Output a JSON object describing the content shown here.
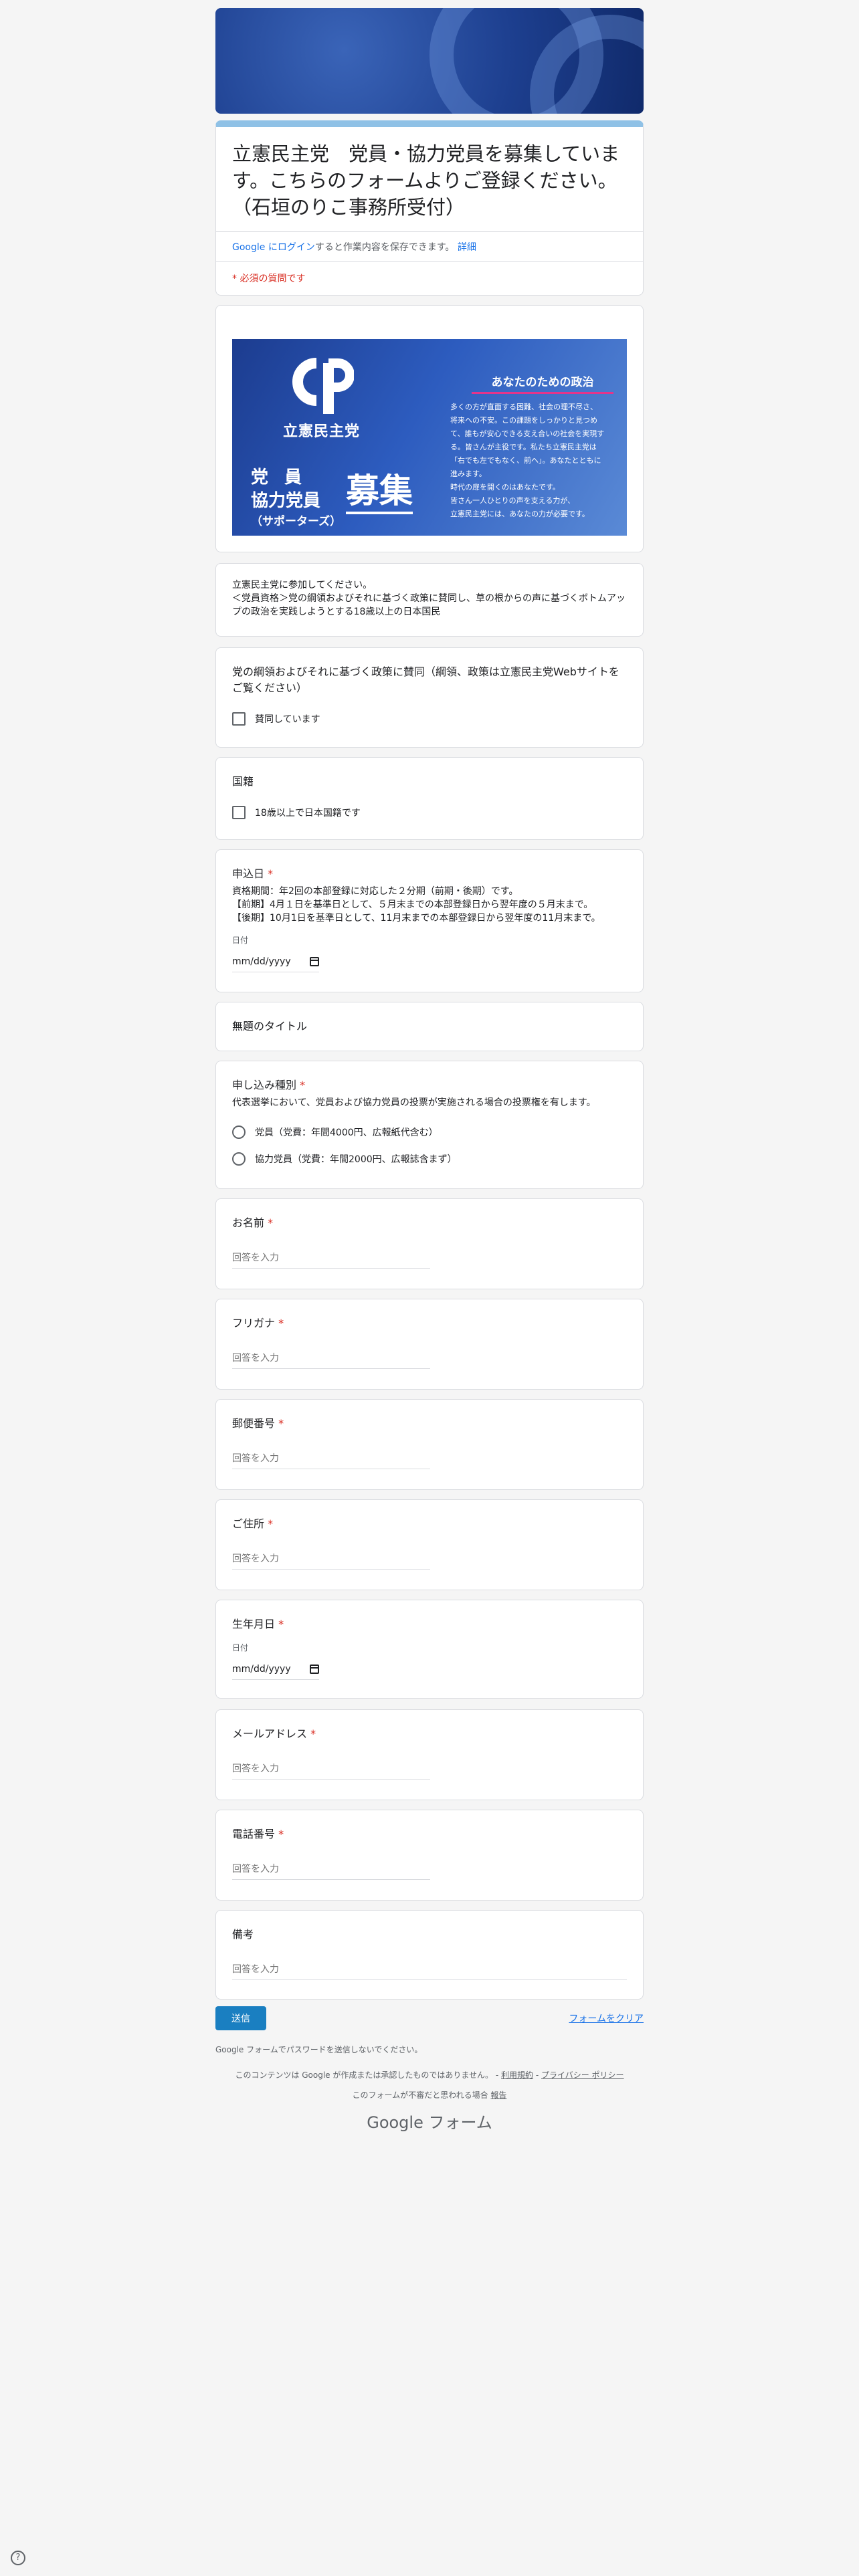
{
  "form": {
    "title": "立憲民主党　党員・協力党員を募集しています。こちらのフォームよりご登録ください。（石垣のりこ事務所受付）",
    "login_prefix": "Google にログイン",
    "login_suffix": "すると作業内容を保存できます。",
    "login_details": "詳細",
    "required_note": "* 必須の質問です"
  },
  "poster": {
    "party_name": "立憲民主党",
    "tagline": "あなたのための政治",
    "body": "多くの方が直面する困難、社会の理不尽さ、\n将来への不安。この課題をしっかりと見つめ\nて、誰もが安心できる支え合いの社会を実現す\nる。皆さんが主役です。私たち立憲民主党は\n「右でも左でもなく、前へ」。あなたとともに\n進みます。\n時代の扉を開くのはあなたです。\n皆さん一人ひとりの声を支える力が、\n立憲民主党には、あなたの力が必要です。",
    "line1": "党員",
    "line2": "協力党員",
    "line3": "（サポーターズ）",
    "big": "募集"
  },
  "intro": {
    "text": "立憲民主党に参加してください。\n＜党員資格＞党の綱領およびそれに基づく政策に賛同し、草の根からの声に基づくボトムアップの政治を実践しようとする18歳以上の日本国民"
  },
  "questions": {
    "platform": {
      "title": "党の綱領およびそれに基づく政策に賛同（綱領、政策は立憲民主党Webサイトをご覧ください）",
      "option": "賛同しています"
    },
    "nationality": {
      "title": "国籍",
      "option": "18歳以上で日本国籍です"
    },
    "apply_date": {
      "title": "申込日",
      "desc": "資格期間：年2回の本部登録に対応した２分期（前期・後期）です。\n【前期】4月１日を基準日として、５月末までの本部登録日から翌年度の５月末まで。\n【後期】10月1日を基準日として、11月末までの本部登録日から翌年度の11月末まで。",
      "date_label": "日付",
      "date_placeholder": "mm/dd/yyyy"
    },
    "untitled": {
      "title": "無題のタイトル"
    },
    "membership_type": {
      "title": "申し込み種別",
      "desc": "代表選挙において、党員および協力党員の投票が実施される場合の投票権を有します。",
      "options": [
        "党員（党費：年間4000円、広報紙代含む）",
        "協力党員（党費：年間2000円、広報誌含まず）"
      ]
    },
    "name": {
      "title": "お名前"
    },
    "furigana": {
      "title": "フリガナ"
    },
    "postal": {
      "title": "郵便番号"
    },
    "address": {
      "title": "ご住所"
    },
    "birthday": {
      "title": "生年月日",
      "date_label": "日付",
      "date_placeholder": "mm/dd/yyyy"
    },
    "email": {
      "title": "メールアドレス"
    },
    "phone": {
      "title": "電話番号"
    },
    "notes": {
      "title": "備考"
    }
  },
  "input_placeholder": "回答を入力",
  "required_mark": "*",
  "actions": {
    "submit": "送信",
    "clear": "フォームをクリア"
  },
  "footer": {
    "password_note": "Google フォームでパスワードを送信しないでください。",
    "legal_text": "このコンテンツは Google が作成または承認したものではありません。 -",
    "terms": "利用規約",
    "privacy": "プライバシー ポリシー",
    "report_text": "このフォームが不審だと思われる場合",
    "report_link": "報告",
    "brand": "Google フォーム",
    "help": "?"
  },
  "colors": {
    "accent": "#8fc1e6",
    "submit": "#1a7fc1",
    "required": "#d93025",
    "link": "#1a73e8"
  }
}
